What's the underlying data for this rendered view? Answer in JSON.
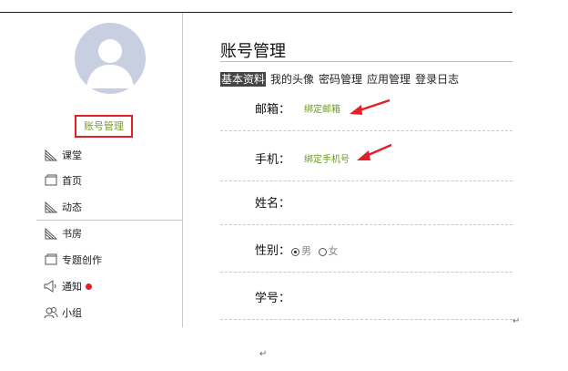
{
  "sidebar": {
    "account_button": "账号管理",
    "items": [
      {
        "label": "课堂",
        "icon": "classroom-icon"
      },
      {
        "label": "首页",
        "icon": "home-icon"
      },
      {
        "label": "动态",
        "icon": "activity-icon"
      },
      {
        "label": "书房",
        "icon": "study-icon"
      },
      {
        "label": "专题创作",
        "icon": "topic-icon"
      },
      {
        "label": "通知",
        "icon": "notification-icon"
      },
      {
        "label": "小组",
        "icon": "group-icon"
      }
    ]
  },
  "main": {
    "title": "账号管理",
    "tabs": [
      "基本资料",
      "我的头像",
      "密码管理",
      "应用管理",
      "登录日志"
    ],
    "active_tab": "基本资料",
    "fields": {
      "email": {
        "label": "邮箱：",
        "link": "绑定邮箱"
      },
      "phone": {
        "label": "手机：",
        "link": "绑定手机号"
      },
      "name": {
        "label": "姓名："
      },
      "gender": {
        "label": "性别：",
        "options": [
          "男",
          "女"
        ],
        "selected": "男"
      },
      "student_id": {
        "label": "学号："
      }
    }
  },
  "colors": {
    "accent_red": "#e2202a",
    "link_green": "#6a9a20",
    "avatar_bg": "#c7cfe0"
  },
  "paragraph_mark": "↵"
}
